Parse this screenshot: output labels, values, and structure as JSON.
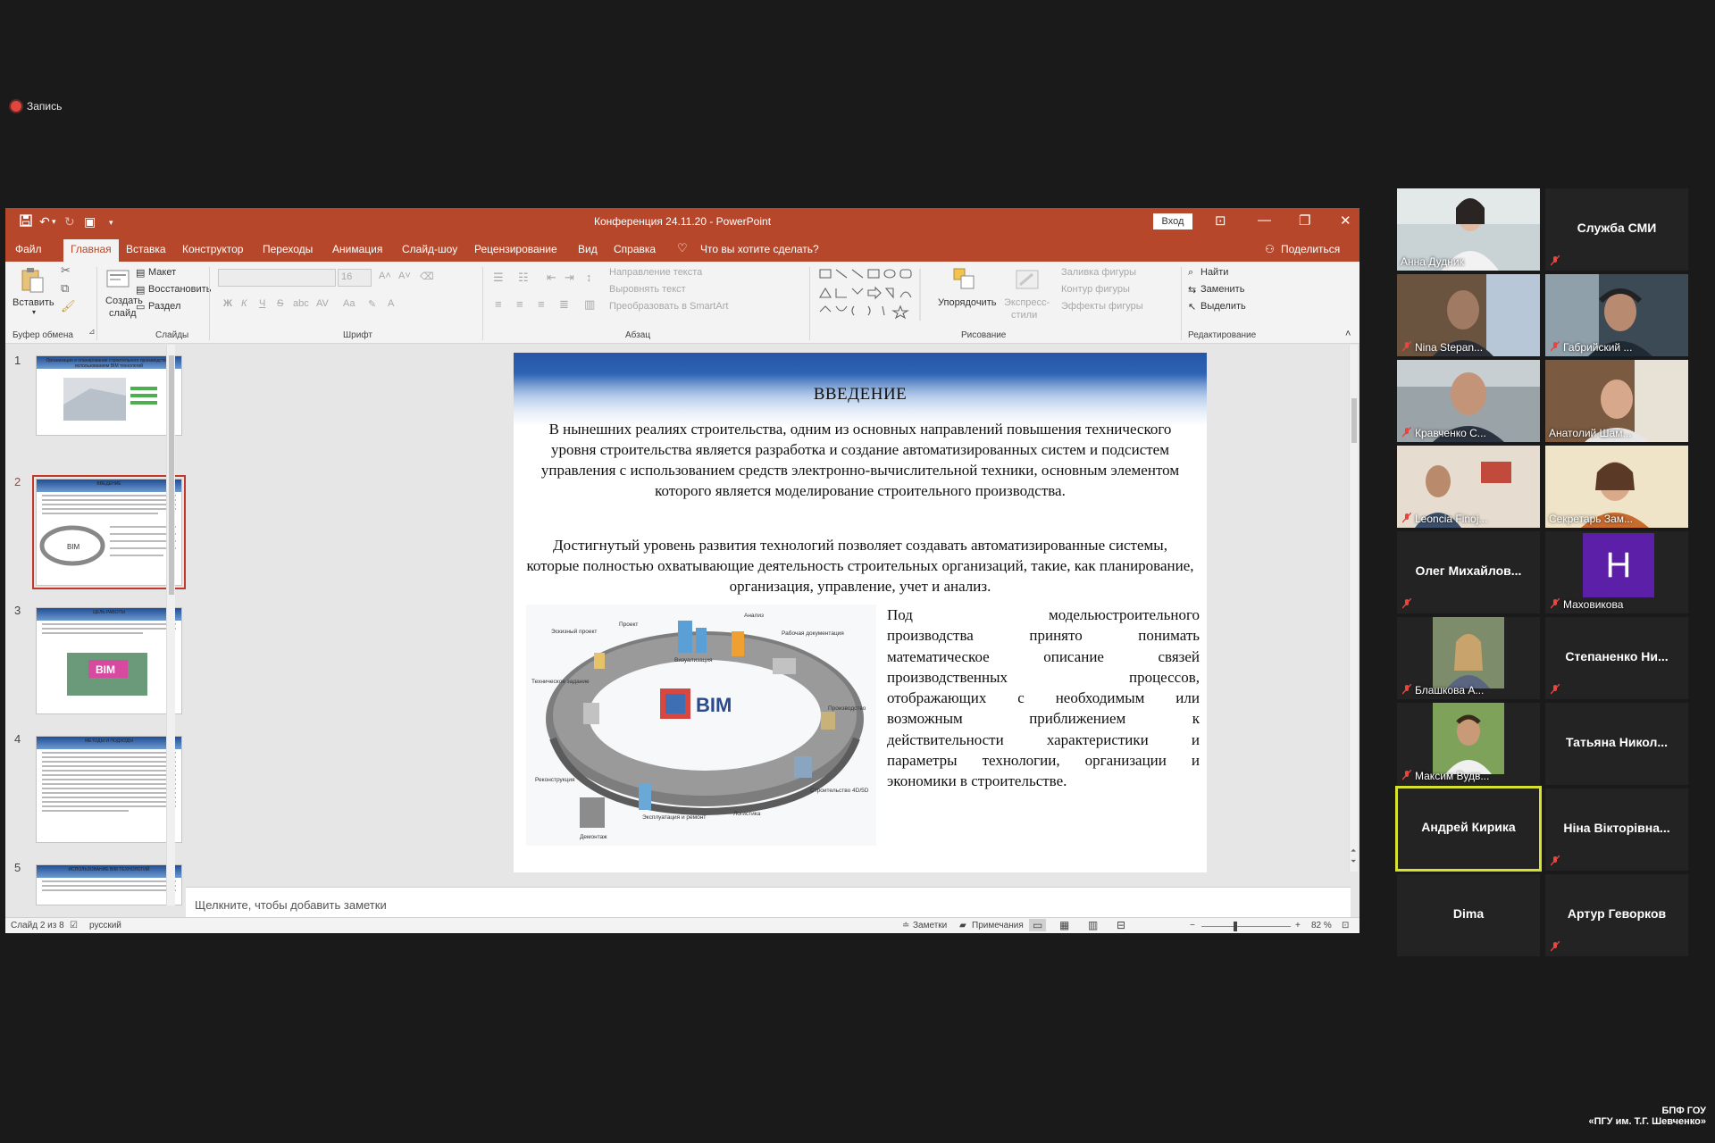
{
  "recording": {
    "label": "Запись"
  },
  "window": {
    "title": "Конференция 24.11.20 - PowerPoint",
    "login_button": "Вход"
  },
  "menu": {
    "tabs": [
      "Файл",
      "Главная",
      "Вставка",
      "Конструктор",
      "Переходы",
      "Анимация",
      "Слайд-шоу",
      "Рецензирование",
      "Вид",
      "Справка"
    ],
    "active_tab": "Главная",
    "search_placeholder": "Что вы хотите сделать?",
    "share": "Поделиться"
  },
  "ribbon": {
    "paste": "Вставить",
    "new_slide_1": "Создать",
    "new_slide_2": "слайд",
    "layout": "Макет",
    "reset": "Восстановить",
    "section": "Раздел",
    "font_size": "16",
    "text_direction": "Направление текста",
    "align_text": "Выровнять текст",
    "smartart": "Преобразовать в SmartArt",
    "arrange": "Упорядочить",
    "quick_styles_1": "Экспресс-",
    "quick_styles_2": "стили",
    "shape_fill": "Заливка фигуры",
    "shape_outline": "Контур фигуры",
    "shape_effects": "Эффекты фигуры",
    "find": "Найти",
    "replace": "Заменить",
    "select": "Выделить",
    "groups": {
      "clipboard": "Буфер обмена",
      "slides": "Слайды",
      "font": "Шрифт",
      "paragraph": "Абзац",
      "drawing": "Рисование",
      "editing": "Редактирование"
    }
  },
  "thumbnails": [
    {
      "num": "1",
      "title": "Организация и планирование строительного производства с использованием BIM технологий"
    },
    {
      "num": "2",
      "title": "ВВЕДЕНИЕ"
    },
    {
      "num": "3",
      "title": "ЦЕЛЬ РАБОТЫ"
    },
    {
      "num": "4",
      "title": "МЕТОДЫ И ПОДХОДЫ"
    },
    {
      "num": "5",
      "title": "ИСПОЛЬЗОВАНИЕ BIM ТЕХНОЛОГИЙ"
    }
  ],
  "slide": {
    "title": "ВВЕДЕНИЕ",
    "para1": "В нынешних реалиях строительства, одним из основных направлений повышения технического уровня строительства является разработка и создание автоматизированных систем и подсистем управления с использованием средств электронно-вычислительной техники, основным элементом которого является моделирование строительного производства.",
    "para2": "Достигнутый уровень развития технологий позволяет создавать автоматизированные системы, которые полностью охватывающие деятельность строительных организаций, такие, как планирование, организация, управление, учет и анализ.",
    "para3_lines": [
      "Под модельюстроительного",
      "производства принято понимать",
      "математическое описание связей",
      "производственных процессов,",
      "отображающих с необходимым или",
      "возможным приближением к",
      "действительности характеристики и",
      "параметры технологии, организации и",
      "экономики в строительстве."
    ],
    "bim": {
      "center": "BIM",
      "labels": [
        "Эскизный проект",
        "Проект",
        "Анализ",
        "Рабочая документация",
        "Визуализация",
        "Техническое задание",
        "Производство",
        "Реконструкция",
        "Эксплуатация и ремонт",
        "Логистика",
        "Строительство 4D/5D",
        "Демонтаж"
      ]
    }
  },
  "notes_placeholder": "Щелкните, чтобы добавить заметки",
  "status": {
    "slide_counter": "Слайд 2 из 8",
    "language": "русский",
    "notes": "Заметки",
    "comments": "Примечания",
    "zoom": "82 %"
  },
  "participants": [
    {
      "name": "Анна Дудник",
      "video": true,
      "muted": false
    },
    {
      "name": "Служба СМИ",
      "video": false,
      "muted": true
    },
    {
      "name": "Nina Stepan...",
      "video": true,
      "muted": true
    },
    {
      "name": "Габрийский ...",
      "video": true,
      "muted": true
    },
    {
      "name": "Кравченко С...",
      "video": true,
      "muted": true
    },
    {
      "name": "Анатолий Шам...",
      "video": true,
      "muted": false
    },
    {
      "name": "Leoncia Finoj...",
      "video": true,
      "muted": true
    },
    {
      "name": "Секретарь Зам...",
      "video": true,
      "muted": false
    },
    {
      "name": "Олег Михайлов...",
      "video": false,
      "muted": true
    },
    {
      "name": "Маховикова",
      "video": false,
      "avatar": "H",
      "muted": true
    },
    {
      "name": "Блашкова А...",
      "video": true,
      "muted": true
    },
    {
      "name": "Степаненко Ни...",
      "video": false,
      "muted": true
    },
    {
      "name": "Максим Вудв...",
      "video": true,
      "muted": true
    },
    {
      "name": "Татьяна Никол...",
      "video": false,
      "muted": false
    },
    {
      "name": "Андрей Кирика",
      "video": false,
      "muted": false,
      "speaking": true
    },
    {
      "name": "Ніна Вікторівна...",
      "video": false,
      "muted": true
    },
    {
      "name": "Dima",
      "video": false,
      "muted": false
    },
    {
      "name": "Артур Геворков",
      "video": false,
      "muted": true
    }
  ],
  "branding": {
    "line1": "БПФ ГОУ",
    "line2": "«ПГУ им. Т.Г. Шевченко»"
  },
  "colors": {
    "accent": "#b7472a",
    "speaking": "#d6e22d",
    "avatar": "#5b1fa8"
  }
}
